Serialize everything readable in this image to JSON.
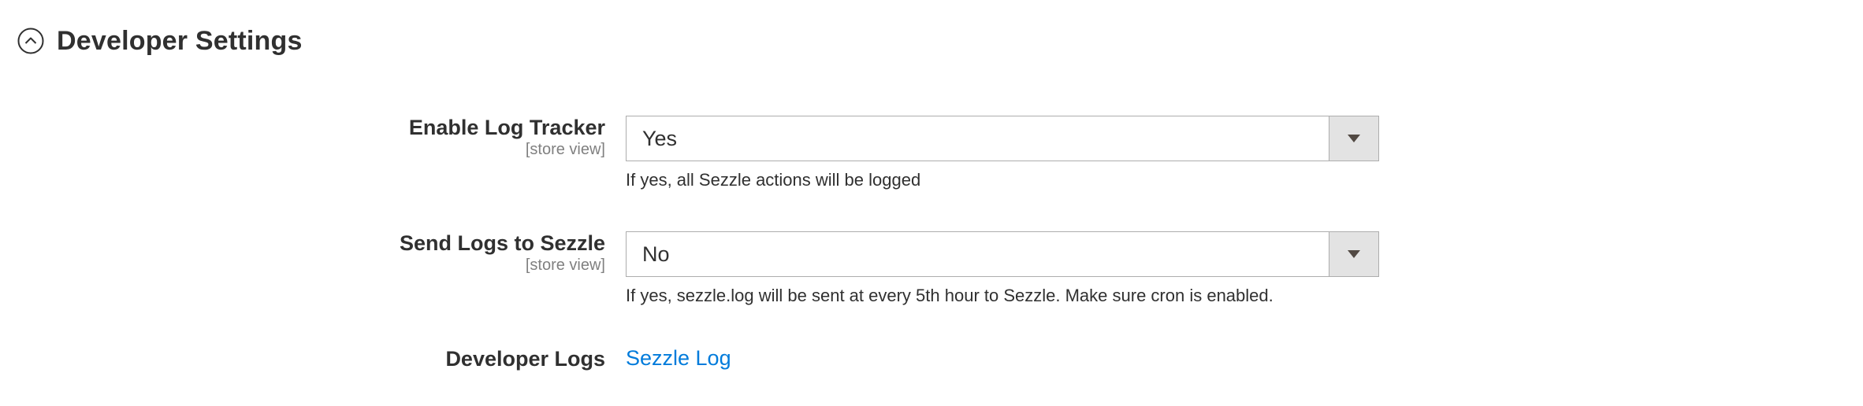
{
  "section": {
    "title": "Developer Settings",
    "toggle_icon": "chevron-up-circle-icon"
  },
  "fields": {
    "log_tracker": {
      "label": "Enable Log Tracker",
      "scope": "[store view]",
      "value": "Yes",
      "note": "If yes, all Sezzle actions will be logged"
    },
    "send_logs": {
      "label": "Send Logs to Sezzle",
      "scope": "[store view]",
      "value": "No",
      "note": "If yes, sezzle.log will be sent at every 5th hour to Sezzle. Make sure cron is enabled."
    },
    "developer_logs": {
      "label": "Developer Logs",
      "link_text": "Sezzle Log"
    }
  },
  "colors": {
    "text": "#303030",
    "scope": "#808080",
    "link": "#007bdb",
    "select_border": "#adadad",
    "arrow_bg": "#e3e3e3"
  }
}
